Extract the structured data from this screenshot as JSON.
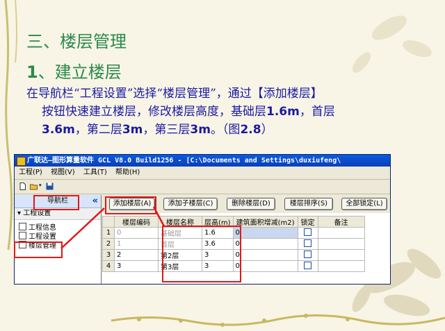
{
  "slide": {
    "title": "三、楼层管理",
    "subtitle_num": "1",
    "subtitle_text": "、建立楼层",
    "body": {
      "p1": "在导航栏“工程设置”选择“楼层管理”，通过【添加楼层】",
      "p2a": "按钮快速建立楼层，修改楼层高度，基础层",
      "p2b": "1.6m",
      "p2c": "，首层",
      "p3a": "3.6m",
      "p3b": "，第二层",
      "p3c": "3m",
      "p3d": "，第三层",
      "p3e": "3m",
      "p3f": "。（图",
      "p3g": "2.8",
      "p3h": "）"
    }
  },
  "window": {
    "title": "广联达—图形算量软件 GCL V8.0 Build1256 - [C:\\Documents and Settings\\duxiufeng\\",
    "menu": [
      "工程(P)",
      "视图(V)",
      "工具(T)",
      "帮助(H)"
    ],
    "nav": {
      "header": "导航栏",
      "collapse": "«",
      "section": "▾ 工程设置",
      "items": [
        "工程信息",
        "工程设置",
        "楼层管理"
      ]
    },
    "buttons": {
      "add_floor": "添加楼层(A)",
      "add_sub_floor": "添加子楼层(C)",
      "delete_floor": "删除楼层(D)",
      "sort_floor": "楼层排序(S)",
      "lock_all": "全部锁定(L)"
    },
    "table": {
      "headers": [
        "楼层编码",
        "楼层名称",
        "层高(m)",
        "建筑面积增减(m2)",
        "锁定",
        "备注"
      ],
      "rows": [
        {
          "num": "1",
          "code": "0",
          "name": "基础层",
          "height": "1.6",
          "area": "0"
        },
        {
          "num": "2",
          "code": "1",
          "name": "首层",
          "height": "3.6",
          "area": "0"
        },
        {
          "num": "3",
          "code": "2",
          "name": "第2层",
          "height": "3",
          "area": "0"
        },
        {
          "num": "4",
          "code": "3",
          "name": "第3层",
          "height": "3",
          "area": "0"
        }
      ]
    }
  },
  "colors": {
    "title": "#2a8a4a",
    "body": "#1a1aa0",
    "highlight": "#e01818",
    "titlebar": "#0a4fd0"
  }
}
